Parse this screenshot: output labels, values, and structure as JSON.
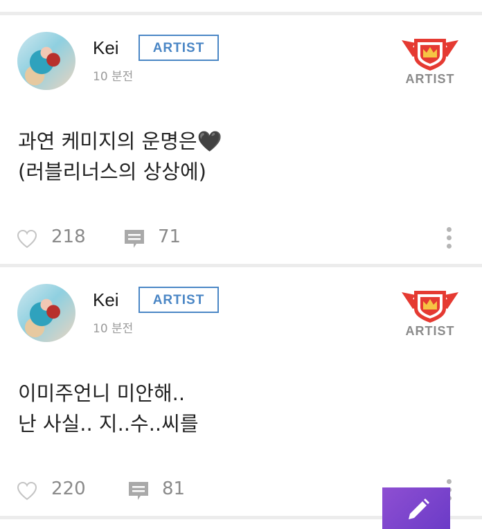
{
  "posts": [
    {
      "author": "Kei",
      "role_badge": "ARTIST",
      "time": "10 분전",
      "emblem_label": "ARTIST",
      "text_lines": [
        "과연 케미지의 운명은🖤",
        "(러블리너스의 상상에)"
      ],
      "likes": "218",
      "comments": "71"
    },
    {
      "author": "Kei",
      "role_badge": "ARTIST",
      "time": "10 분전",
      "emblem_label": "ARTIST",
      "text_lines": [
        "이미주언니 미안해..",
        "난 사실.. 지..수..씨를"
      ],
      "likes": "220",
      "comments": "81"
    }
  ],
  "icons": {
    "like": "heart-outline-icon",
    "comment": "comment-bubble-icon",
    "more": "more-vertical-icon",
    "compose": "pencil-icon",
    "emblem": "winged-crown-shield-icon"
  },
  "colors": {
    "badge_blue": "#4a86c5",
    "emblem_red": "#e53a32",
    "crown_yellow": "#f6c544",
    "fab_purple": "#7d45cc"
  }
}
